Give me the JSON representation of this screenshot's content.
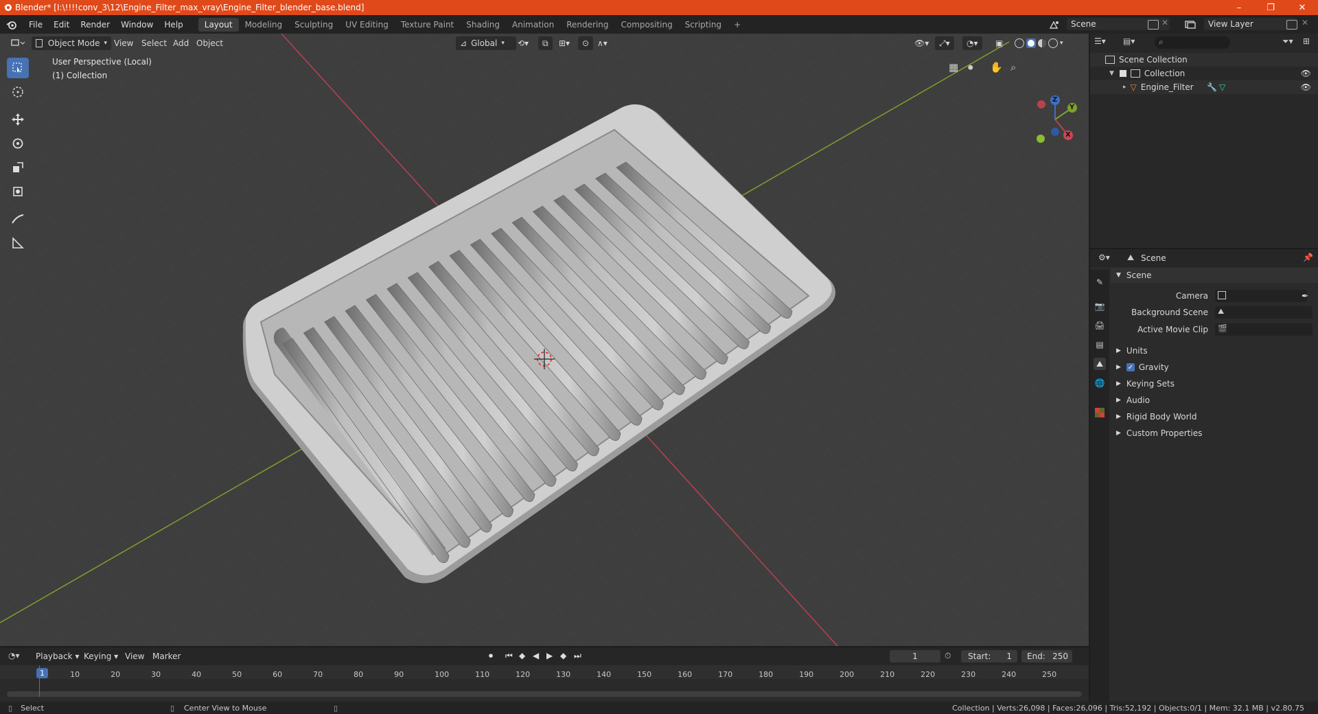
{
  "window": {
    "title": "Blender* [I:\\!!!!conv_3\\12\\Engine_Filter_max_vray\\Engine_Filter_blender_base.blend]",
    "minimize": "–",
    "maximize": "❐",
    "close": "✕"
  },
  "menubar": {
    "items": [
      "File",
      "Edit",
      "Render",
      "Window",
      "Help"
    ],
    "workspaces": [
      "Layout",
      "Modeling",
      "Sculpting",
      "UV Editing",
      "Texture Paint",
      "Shading",
      "Animation",
      "Rendering",
      "Compositing",
      "Scripting"
    ],
    "active_workspace": "Layout",
    "add_workspace": "+",
    "scene_label": "Scene",
    "view_layer_label": "View Layer"
  },
  "viewport": {
    "mode": "Object Mode",
    "menus": [
      "View",
      "Select",
      "Add",
      "Object"
    ],
    "transform_orientation": "Global",
    "perspective_label": "User Perspective (Local)",
    "collection_label": "(1) Collection",
    "gizmo_axes": [
      "Z",
      "Y",
      "X"
    ],
    "colors": {
      "background": "#3e3e3e",
      "x_axis": "#b8424e",
      "y_axis": "#7ea02e",
      "active_tool": "#4772b3"
    }
  },
  "outliner": {
    "root": "Scene Collection",
    "collection": "Collection",
    "object": "Engine_Filter"
  },
  "properties": {
    "context": "Scene",
    "panel_title": "Scene",
    "fields": [
      {
        "label": "Camera"
      },
      {
        "label": "Background Scene"
      },
      {
        "label": "Active Movie Clip"
      }
    ],
    "sections": [
      "Units",
      "Gravity",
      "Keying Sets",
      "Audio",
      "Rigid Body World",
      "Custom Properties"
    ],
    "gravity_checked": true
  },
  "timeline": {
    "menus": [
      "Playback",
      "Keying",
      "View",
      "Marker"
    ],
    "current_frame": "1",
    "start_label": "Start:",
    "start": "1",
    "end_label": "End:",
    "end": "250",
    "ticks": [
      "1",
      "10",
      "20",
      "30",
      "40",
      "50",
      "60",
      "70",
      "80",
      "90",
      "100",
      "110",
      "120",
      "130",
      "140",
      "150",
      "160",
      "170",
      "180",
      "190",
      "200",
      "210",
      "220",
      "230",
      "240",
      "250"
    ]
  },
  "statusbar": {
    "left_action": "Select",
    "middle_action": "Center View to Mouse",
    "stats": "Collection | Verts:26,098 | Faces:26,096 | Tris:52,192 | Objects:0/1 | Mem: 32.1 MB | v2.80.75"
  }
}
